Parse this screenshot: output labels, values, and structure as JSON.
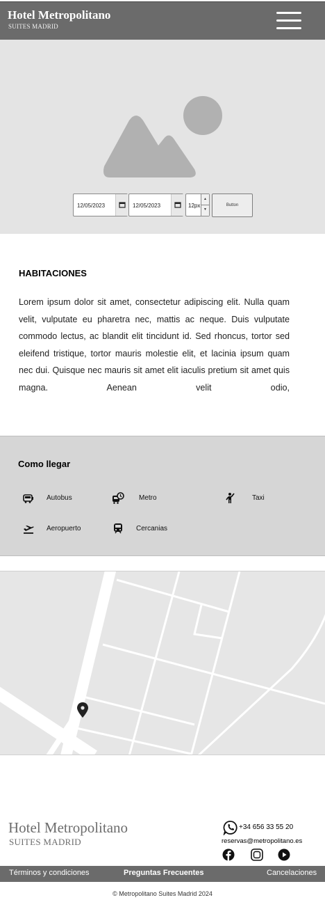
{
  "header": {
    "brand_title": "Hotel Metropolitano",
    "brand_subtitle": "SUITES MADRID",
    "menu_icon": "hamburger-menu-icon"
  },
  "hero": {
    "image_icon": "image-placeholder-icon",
    "date_from": "12/05/2023",
    "date_to": "12/05/2023",
    "number_value": "12px",
    "button_label": "Button"
  },
  "habitaciones": {
    "title": "HABITACIONES",
    "body": "Lorem ipsum dolor sit amet, consectetur adipiscing elit. Nulla quam velit, vulputate eu pharetra nec, mattis ac neque. Duis vulputate commodo lectus, ac blandit elit tincidunt id. Sed rhoncus, tortor sed eleifend tristique, tortor mauris molestie elit, et lacinia ipsum quam nec dui. Quisque nec mauris sit amet elit iaculis pretium sit amet quis magna. Aenean velit odio,"
  },
  "como_llegar": {
    "title": "Como llegar",
    "items": [
      {
        "label": "Autobus",
        "icon": "bus-icon"
      },
      {
        "label": "Metro",
        "icon": "metro-clock-icon"
      },
      {
        "label": "Taxi",
        "icon": "taxi-hail-icon"
      },
      {
        "label": "Aeropuerto",
        "icon": "airplane-departure-icon"
      },
      {
        "label": "Cercanias",
        "icon": "train-icon"
      }
    ]
  },
  "map": {
    "pin_icon": "location-pin-icon"
  },
  "footer": {
    "brand_title": "Hotel Metropolitano",
    "brand_subtitle": "SUITES MADRID",
    "phone": "+34 656 33 55 20",
    "email": "reservas@metropolitano.es",
    "social": [
      "facebook-icon",
      "instagram-icon",
      "youtube-icon"
    ],
    "links": {
      "terms": "Términos y condiciones",
      "faq": "Preguntas Frecuentes",
      "cancel": "Cancelaciones"
    },
    "copyright": "© Metropolitano Suites Madrid 2024"
  }
}
